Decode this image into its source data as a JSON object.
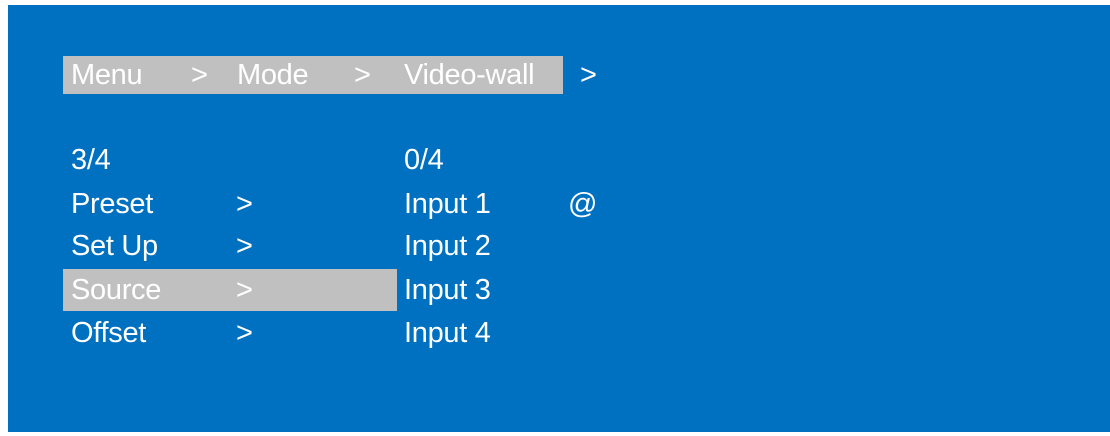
{
  "breadcrumb": {
    "items": [
      "Menu",
      "Mode",
      "Video-wall"
    ],
    "separators": [
      ">",
      ">",
      ">"
    ]
  },
  "left_menu": {
    "page_counter": "3/4",
    "items": [
      {
        "label": "Preset",
        "arrow": ">"
      },
      {
        "label": "Set Up",
        "arrow": ">"
      },
      {
        "label": "Source",
        "arrow": ">",
        "selected": true
      },
      {
        "label": "Offset",
        "arrow": ">"
      }
    ]
  },
  "right_menu": {
    "page_counter": "0/4",
    "items": [
      {
        "label": "Input 1",
        "marker": "@"
      },
      {
        "label": "Input 2"
      },
      {
        "label": "Input 3"
      },
      {
        "label": "Input 4"
      }
    ]
  },
  "colors": {
    "background": "#0070c0",
    "highlight": "#c0c0c0",
    "text": "#ffffff"
  }
}
